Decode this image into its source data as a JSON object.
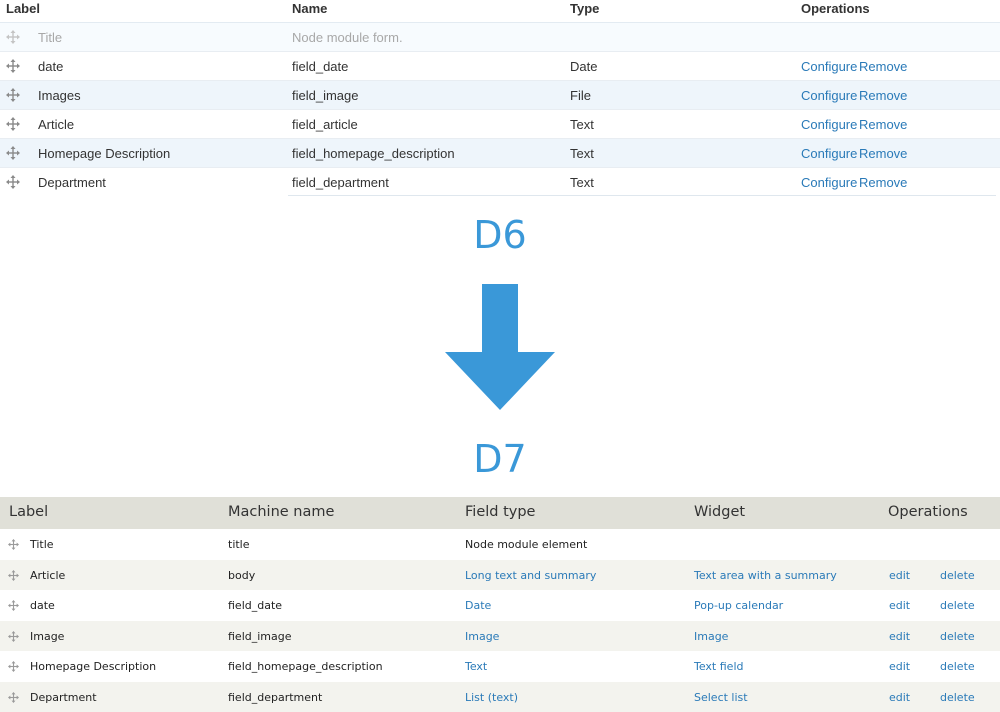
{
  "d6": {
    "headers": {
      "label": "Label",
      "name": "Name",
      "type": "Type",
      "operations": "Operations"
    },
    "rows": [
      {
        "label": "Title",
        "name": "Node module form.",
        "type": "",
        "op1": "",
        "op2": ""
      },
      {
        "label": "date",
        "name": "field_date",
        "type": "Date",
        "op1": "Configure",
        "op2": "Remove"
      },
      {
        "label": "Images",
        "name": "field_image",
        "type": "File",
        "op1": "Configure",
        "op2": "Remove"
      },
      {
        "label": "Article",
        "name": "field_article",
        "type": "Text",
        "op1": "Configure",
        "op2": "Remove"
      },
      {
        "label": "Homepage Description",
        "name": "field_homepage_description",
        "type": "Text",
        "op1": "Configure",
        "op2": "Remove"
      },
      {
        "label": "Department",
        "name": "field_department",
        "type": "Text",
        "op1": "Configure",
        "op2": "Remove"
      }
    ]
  },
  "labels": {
    "d6": "D6",
    "d7": "D7"
  },
  "colors": {
    "accent": "#3a98d8",
    "link": "#2a7ab8",
    "d7_header_bg": "#e0e0d8",
    "d7_stripe": "#f3f3ee",
    "d6_stripe": "#eef5fb"
  },
  "d7": {
    "headers": {
      "label": "Label",
      "machine": "Machine name",
      "field_type": "Field type",
      "widget": "Widget",
      "operations": "Operations"
    },
    "rows": [
      {
        "label": "Title",
        "machine": "title",
        "field_type": "Node module element",
        "widget": "",
        "edit": "",
        "delete": ""
      },
      {
        "label": "Article",
        "machine": "body",
        "field_type": "Long text and summary",
        "widget": "Text area with a summary",
        "edit": "edit",
        "delete": "delete"
      },
      {
        "label": "date",
        "machine": "field_date",
        "field_type": "Date",
        "widget": "Pop-up calendar",
        "edit": "edit",
        "delete": "delete"
      },
      {
        "label": "Image",
        "machine": "field_image",
        "field_type": "Image",
        "widget": "Image",
        "edit": "edit",
        "delete": "delete"
      },
      {
        "label": "Homepage Description",
        "machine": "field_homepage_description",
        "field_type": "Text",
        "widget": "Text field",
        "edit": "edit",
        "delete": "delete"
      },
      {
        "label": "Department",
        "machine": "field_department",
        "field_type": "List (text)",
        "widget": "Select list",
        "edit": "edit",
        "delete": "delete"
      }
    ]
  }
}
